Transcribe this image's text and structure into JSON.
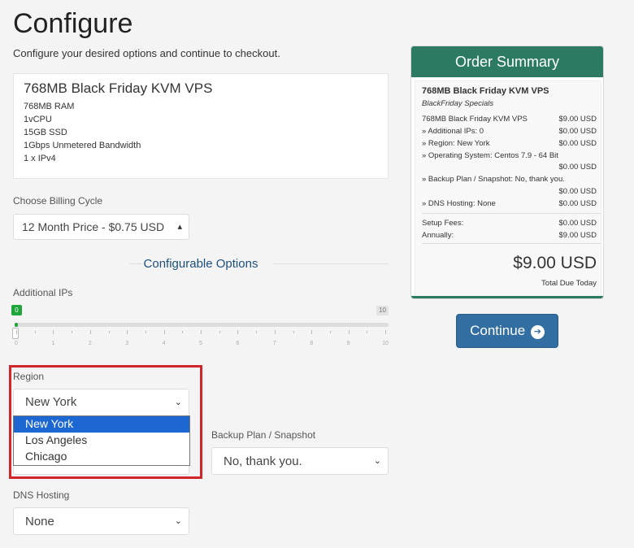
{
  "page": {
    "title": "Configure",
    "subtitle": "Configure your desired options and continue to checkout."
  },
  "product": {
    "name": "768MB Black Friday KVM VPS",
    "features": [
      "768MB RAM",
      "1vCPU",
      "15GB SSD",
      "1Gbps Unmetered Bandwidth",
      "1 x IPv4"
    ]
  },
  "billing": {
    "label": "Choose Billing Cycle",
    "value": "12 Month Price - $0.75 USD"
  },
  "configurable": {
    "heading": "Configurable Options"
  },
  "additional_ips": {
    "label": "Additional IPs",
    "value": 0,
    "min_label": "0",
    "max_label": "10",
    "tick_labels": [
      "0",
      "1",
      "2",
      "3",
      "4",
      "5",
      "6",
      "7",
      "8",
      "9",
      "10"
    ]
  },
  "region": {
    "label": "Region",
    "value": "New York",
    "options": [
      "New York",
      "Los Angeles",
      "Chicago"
    ]
  },
  "backup": {
    "label": "Backup Plan / Snapshot",
    "value": "No, thank you."
  },
  "dns": {
    "label": "DNS Hosting",
    "value": "None"
  },
  "summary": {
    "title": "Order Summary",
    "product": "768MB Black Friday KVM VPS",
    "group": "BlackFriday Specials",
    "lines": {
      "base_label": "768MB Black Friday KVM VPS",
      "base_price": "$9.00 USD",
      "ips_label": "» Additional IPs: 0",
      "ips_price": "$0.00 USD",
      "region_label": "» Region: New York",
      "region_price": "$0.00 USD",
      "os_label": "» Operating System: Centos 7.9 - 64 Bit",
      "os_price": "$0.00 USD",
      "backup_label": "» Backup Plan / Snapshot: No, thank you.",
      "backup_price": "$0.00 USD",
      "dns_label": "» DNS Hosting: None",
      "dns_price": "$0.00 USD"
    },
    "setup_label": "Setup Fees:",
    "setup_price": "$0.00 USD",
    "annual_label": "Annually:",
    "annual_price": "$9.00 USD",
    "total": "$9.00 USD",
    "total_label": "Total Due Today"
  },
  "continue": {
    "label": "Continue"
  },
  "colors": {
    "accent": "#2d7a63",
    "button": "#336ea3",
    "highlight": "#d0262a",
    "slider": "#1fa53a"
  }
}
